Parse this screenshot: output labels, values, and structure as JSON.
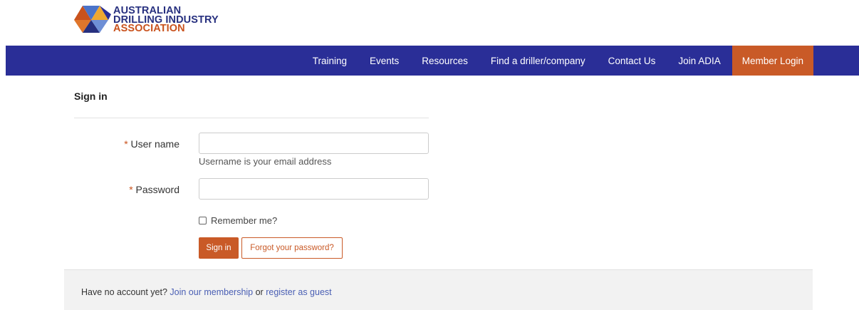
{
  "brand": {
    "line1": "AUSTRALIAN",
    "line2": "DRILLING INDUSTRY",
    "line3": "ASSOCIATION",
    "colors": {
      "navy": "#27307f",
      "orange": "#c9521d",
      "nav_bg": "#2a2e97"
    }
  },
  "nav": {
    "items": [
      "Training",
      "Events",
      "Resources",
      "Find a driller/company",
      "Contact Us",
      "Join ADIA"
    ],
    "login_label": "Member Login"
  },
  "signin": {
    "title": "Sign in",
    "required_mark": "*",
    "username_label": "User name",
    "username_value": "",
    "username_help": "Username is your email address",
    "password_label": "Password",
    "password_value": "",
    "remember_label": "Remember me?",
    "remember_checked": false,
    "submit_label": "Sign in",
    "forgot_label": "Forgot your password?"
  },
  "footer": {
    "prefix": "Have no account yet?",
    "join_link": "Join our membership",
    "or": "or",
    "guest_link": "register as guest"
  }
}
